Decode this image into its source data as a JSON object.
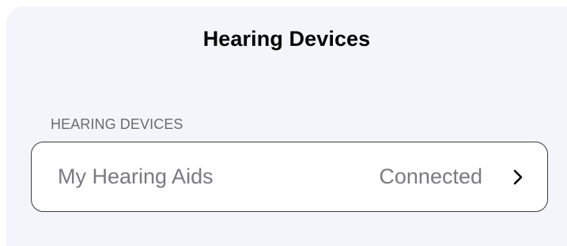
{
  "nav": {
    "title": "Hearing Devices"
  },
  "section": {
    "header": "HEARING DEVICES"
  },
  "rows": [
    {
      "label": "My Hearing Aids",
      "value": "Connected",
      "accessory_icon": "chevron-right-icon"
    }
  ],
  "colors": {
    "background": "#f4f5fa",
    "row_background": "#ffffff",
    "secondary_text": "#7a7a80",
    "section_header_text": "#6b6b70",
    "title_text": "#000000"
  }
}
